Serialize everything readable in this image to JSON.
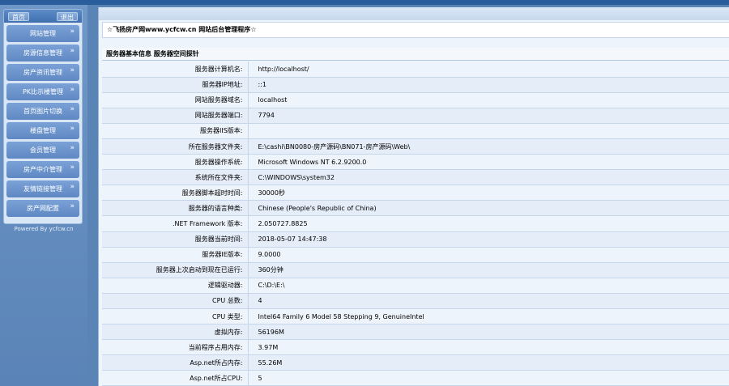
{
  "sidebar": {
    "head_left": "首页",
    "head_right": "退出",
    "items": [
      {
        "label": "网站管理"
      },
      {
        "label": "房源信息管理"
      },
      {
        "label": "房产资讯管理"
      },
      {
        "label": "PK比示楼管理"
      },
      {
        "label": "首页图片切换"
      },
      {
        "label": "楼盘管理"
      },
      {
        "label": "会员管理"
      },
      {
        "label": "房产中介管理"
      },
      {
        "label": "友情链接管理"
      },
      {
        "label": "房产网配置"
      }
    ],
    "powered": "Powered By ycfcw.cn"
  },
  "main": {
    "title": "☆飞扬房产网www.ycfcw.cn 网站后台管理程序☆",
    "section_title": "服务器基本信息 服务器空间探针",
    "rows": [
      {
        "k": "服务器计算机名:",
        "v": "http://localhost/"
      },
      {
        "k": "服务器IP地址:",
        "v": "::1"
      },
      {
        "k": "网站服务器域名:",
        "v": "localhost"
      },
      {
        "k": "网站服务器端口:",
        "v": "7794"
      },
      {
        "k": "服务器IIS版本:",
        "v": ""
      },
      {
        "k": "所在服务器文件夹:",
        "v": "E:\\cashi\\BN0080-房产源码\\BN071-房产源码\\Web\\"
      },
      {
        "k": "服务器操作系统:",
        "v": "Microsoft Windows NT 6.2.9200.0"
      },
      {
        "k": "系统所在文件夹:",
        "v": "C:\\WINDOWS\\system32"
      },
      {
        "k": "服务器脚本超时时间:",
        "v": "30000秒"
      },
      {
        "k": "服务器的语言种类:",
        "v": "Chinese (People's Republic of China)"
      },
      {
        "k": ".NET Framework 版本:",
        "v": "2.050727.8825"
      },
      {
        "k": "服务器当前时间:",
        "v": "2018-05-07 14:47:38"
      },
      {
        "k": "服务器IE版本:",
        "v": "9.0000"
      },
      {
        "k": "服务器上次启动到现在已运行:",
        "v": "360分钟"
      },
      {
        "k": "逻辑驱动器:",
        "v": "C:\\D:\\E:\\"
      },
      {
        "k": "CPU 总数:",
        "v": "4"
      },
      {
        "k": "CPU 类型:",
        "v": "Intel64 Family 6 Model 58 Stepping 9, GenuineIntel"
      },
      {
        "k": "虚拟内存:",
        "v": "56196M"
      },
      {
        "k": "当前程序占用内存:",
        "v": "3.97M"
      },
      {
        "k": "Asp.net所占内存:",
        "v": "55.26M"
      },
      {
        "k": "Asp.net所占CPU:",
        "v": "5"
      }
    ]
  }
}
